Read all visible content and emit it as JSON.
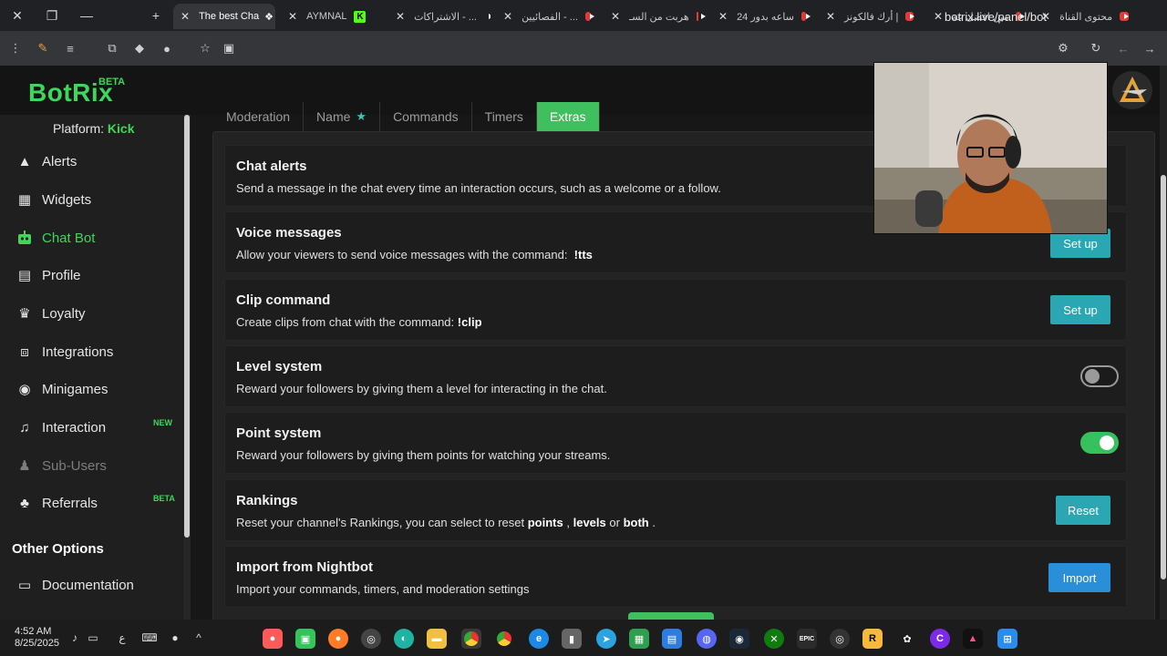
{
  "browser": {
    "tabs": [
      {
        "label": "The best Cha",
        "active": true
      },
      {
        "label": "AYMNAL"
      },
      {
        "label": "الاشتراكات - ..."
      },
      {
        "label": "الفصائيين - ..."
      },
      {
        "label": "هربت من السـ"
      },
      {
        "label": "24 ساعه بدور"
      },
      {
        "label": "أرك فالكونز |"
      },
      {
        "label": "مين افضل عة"
      },
      {
        "label": "محتوى القناة"
      }
    ],
    "url": "botrix.live/panel/bot"
  },
  "header": {
    "logo": "BotRix",
    "logo_badge": "BETA"
  },
  "sidebar": {
    "platform_label": "Platform:",
    "platform_value": "Kick",
    "items": [
      {
        "label": "Alerts",
        "icon": "warning-icon"
      },
      {
        "label": "Widgets",
        "icon": "grid-icon"
      },
      {
        "label": "Chat Bot",
        "icon": "robot-icon",
        "active": true
      },
      {
        "label": "Profile",
        "icon": "id-card-icon"
      },
      {
        "label": "Loyalty",
        "icon": "trophy-icon"
      },
      {
        "label": "Integrations",
        "icon": "plug-icon"
      },
      {
        "label": "Minigames",
        "icon": "gamepad-icon"
      },
      {
        "label": "Interaction",
        "icon": "music-icon",
        "badge": "NEW"
      },
      {
        "label": "Sub-Users",
        "icon": "users-icon",
        "disabled": true
      },
      {
        "label": "Referrals",
        "icon": "group-icon",
        "badge": "BETA"
      }
    ],
    "other_title": "Other Options",
    "other_items": [
      {
        "label": "Documentation",
        "icon": "book-icon"
      }
    ]
  },
  "main": {
    "tabs": [
      {
        "label": "Moderation"
      },
      {
        "label": "Name"
      },
      {
        "label": "Commands"
      },
      {
        "label": "Timers"
      },
      {
        "label": "Extras",
        "active": true
      }
    ],
    "cards": [
      {
        "title": "Chat alerts",
        "desc": "Send a message in the chat every time an interaction occurs, such as a welcome or a follow."
      },
      {
        "title": "Voice messages",
        "desc": "Allow your viewers to send voice messages with the command:",
        "cmd": "!tts",
        "button": "Set up"
      },
      {
        "title": "Clip command",
        "desc": "Create clips from chat with the command:",
        "cmd": "!clip",
        "button": "Set up"
      },
      {
        "title": "Level system",
        "desc": "Reward your followers by giving them a level for interacting in the chat.",
        "toggle": false
      },
      {
        "title": "Point system",
        "desc": "Reward your followers by giving them points for watching your streams.",
        "toggle": true
      },
      {
        "title": "Rankings",
        "desc_pre": "Reset your channel's Rankings, you can select to reset",
        "w1": "points",
        "sep1": ",",
        "w2": "levels",
        "sep2": "or",
        "w3": "both",
        "end": ".",
        "button": "Reset"
      },
      {
        "title": "Import from Nightbot",
        "desc": "Import your commands, timers, and moderation settings",
        "button": "Import"
      }
    ]
  },
  "taskbar": {
    "time": "4:52 AM",
    "date": "8/25/2025",
    "lang": "ع"
  }
}
